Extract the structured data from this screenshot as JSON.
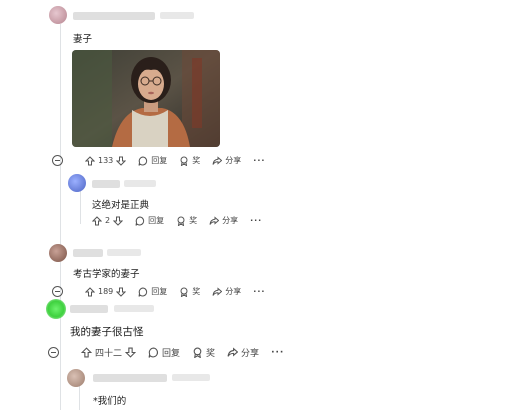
{
  "comments": [
    {
      "id": "c1",
      "text": "妻子",
      "has_image": true,
      "actions": {
        "upvotes": "133",
        "reply": "回复",
        "award": "奖",
        "share": "分享",
        "more": "···"
      }
    },
    {
      "id": "c2",
      "text": "这绝对是正典",
      "actions": {
        "upvotes": "2",
        "reply": "回复",
        "award": "奖",
        "share": "分享",
        "more": "···"
      }
    },
    {
      "id": "c3",
      "text": "考古学家的妻子",
      "actions": {
        "upvotes": "189",
        "reply": "回复",
        "award": "奖",
        "share": "分享",
        "more": "···"
      }
    },
    {
      "id": "c4",
      "text": "我的妻子很古怪",
      "actions": {
        "upvotes": "四十二",
        "reply": "回复",
        "award": "奖",
        "share": "分享",
        "more": "···"
      }
    },
    {
      "id": "c5",
      "text": "*我们的"
    }
  ],
  "colors": {
    "avatar_c1": "#c79aa6",
    "avatar_c2": "#6a83d6",
    "avatar_c3": "#a07666",
    "avatar_c4": "#3fd13f",
    "avatar_c5": "#b89a8a"
  }
}
